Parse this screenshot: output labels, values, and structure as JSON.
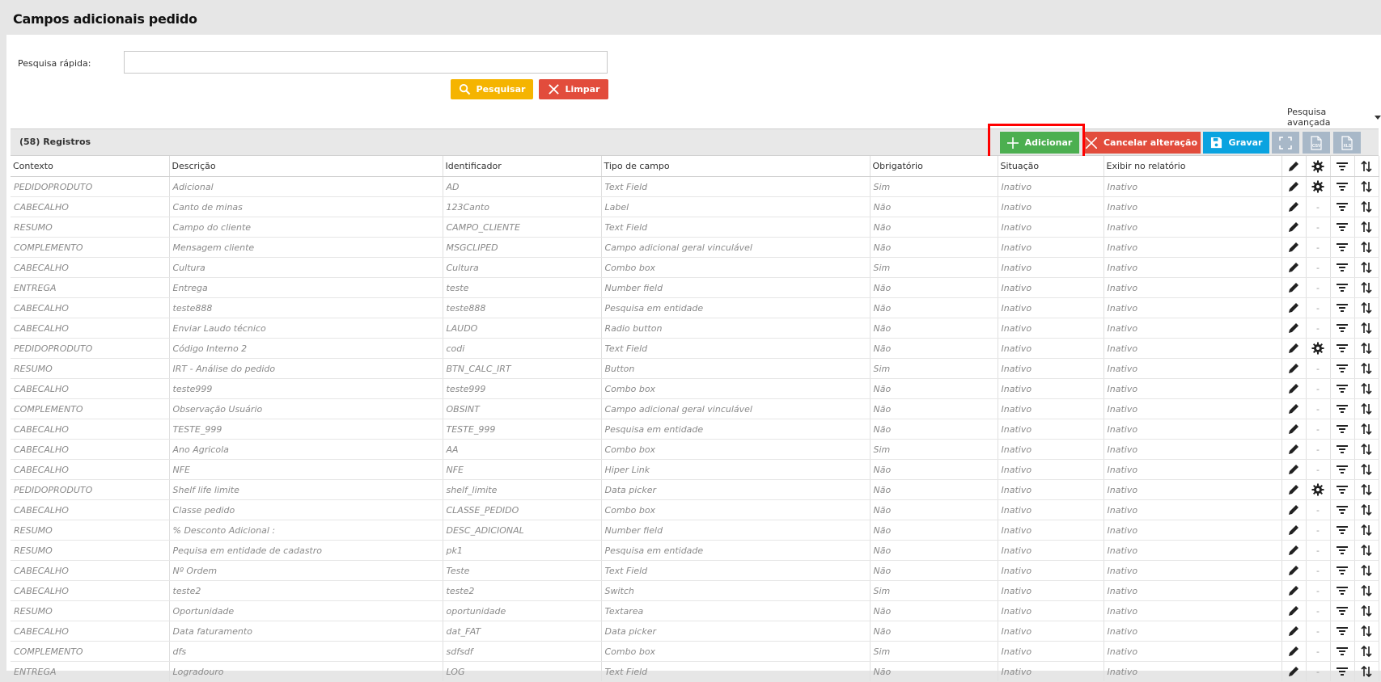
{
  "page": {
    "title": "Campos adicionais pedido"
  },
  "search": {
    "label": "Pesquisa rápida:",
    "value": "",
    "placeholder": "",
    "search_button": "Pesquisar",
    "clear_button": "Limpar",
    "advanced": "Pesquisa avançada"
  },
  "grid": {
    "count_label": "(58) Registros",
    "toolbar": {
      "add": "Adicionar",
      "cancel": "Cancelar alteração",
      "save": "Gravar",
      "expand_icon": "fullscreen-icon",
      "csv_icon": "csv-export-icon",
      "xls_icon": "xls-export-icon"
    },
    "columns": [
      "Contexto",
      "Descrição",
      "Identificador",
      "Tipo de campo",
      "Obrigatório",
      "Situação",
      "Exibir no relatório"
    ],
    "rows": [
      {
        "contexto": "PEDIDOPRODUTO",
        "descricao": "Adicional",
        "identificador": "AD",
        "tipo": "Text Field",
        "obrigatorio": "Sim",
        "situacao": "Inativo",
        "exibir": "Inativo",
        "gear": true
      },
      {
        "contexto": "CABECALHO",
        "descricao": "Canto de minas",
        "identificador": "123Canto",
        "tipo": "Label",
        "obrigatorio": "Não",
        "situacao": "Inativo",
        "exibir": "Inativo",
        "gear": false
      },
      {
        "contexto": "RESUMO",
        "descricao": "Campo do cliente",
        "identificador": "CAMPO_CLIENTE",
        "tipo": "Text Field",
        "obrigatorio": "Não",
        "situacao": "Inativo",
        "exibir": "Inativo",
        "gear": false
      },
      {
        "contexto": "COMPLEMENTO",
        "descricao": "Mensagem cliente",
        "identificador": "MSGCLIPED",
        "tipo": "Campo adicional geral vinculável",
        "obrigatorio": "Não",
        "situacao": "Inativo",
        "exibir": "Inativo",
        "gear": false
      },
      {
        "contexto": "CABECALHO",
        "descricao": "Cultura",
        "identificador": "Cultura",
        "tipo": "Combo box",
        "obrigatorio": "Sim",
        "situacao": "Inativo",
        "exibir": "Inativo",
        "gear": false
      },
      {
        "contexto": "ENTREGA",
        "descricao": "Entrega",
        "identificador": "teste",
        "tipo": "Number field",
        "obrigatorio": "Não",
        "situacao": "Inativo",
        "exibir": "Inativo",
        "gear": false
      },
      {
        "contexto": "CABECALHO",
        "descricao": "teste888",
        "identificador": "teste888",
        "tipo": "Pesquisa em entidade",
        "obrigatorio": "Não",
        "situacao": "Inativo",
        "exibir": "Inativo",
        "gear": false
      },
      {
        "contexto": "CABECALHO",
        "descricao": "Enviar Laudo técnico",
        "identificador": "LAUDO",
        "tipo": "Radio button",
        "obrigatorio": "Não",
        "situacao": "Inativo",
        "exibir": "Inativo",
        "gear": false
      },
      {
        "contexto": "PEDIDOPRODUTO",
        "descricao": "Código Interno 2",
        "identificador": "codi",
        "tipo": "Text Field",
        "obrigatorio": "Não",
        "situacao": "Inativo",
        "exibir": "Inativo",
        "gear": true
      },
      {
        "contexto": "RESUMO",
        "descricao": "IRT - Análise do pedido",
        "identificador": "BTN_CALC_IRT",
        "tipo": "Button",
        "obrigatorio": "Sim",
        "situacao": "Inativo",
        "exibir": "Inativo",
        "gear": false
      },
      {
        "contexto": "CABECALHO",
        "descricao": "teste999",
        "identificador": "teste999",
        "tipo": "Combo box",
        "obrigatorio": "Não",
        "situacao": "Inativo",
        "exibir": "Inativo",
        "gear": false
      },
      {
        "contexto": "COMPLEMENTO",
        "descricao": "Observação Usuário",
        "identificador": "OBSINT",
        "tipo": "Campo adicional geral vinculável",
        "obrigatorio": "Não",
        "situacao": "Inativo",
        "exibir": "Inativo",
        "gear": false
      },
      {
        "contexto": "CABECALHO",
        "descricao": "TESTE_999",
        "identificador": "TESTE_999",
        "tipo": "Pesquisa em entidade",
        "obrigatorio": "Não",
        "situacao": "Inativo",
        "exibir": "Inativo",
        "gear": false
      },
      {
        "contexto": "CABECALHO",
        "descricao": "Ano Agricola",
        "identificador": "AA",
        "tipo": "Combo box",
        "obrigatorio": "Sim",
        "situacao": "Inativo",
        "exibir": "Inativo",
        "gear": false
      },
      {
        "contexto": "CABECALHO",
        "descricao": "NFE",
        "identificador": "NFE",
        "tipo": "Hiper Link",
        "obrigatorio": "Não",
        "situacao": "Inativo",
        "exibir": "Inativo",
        "gear": false
      },
      {
        "contexto": "PEDIDOPRODUTO",
        "descricao": "Shelf life limite",
        "identificador": "shelf_limite",
        "tipo": "Data picker",
        "obrigatorio": "Não",
        "situacao": "Inativo",
        "exibir": "Inativo",
        "gear": true
      },
      {
        "contexto": "CABECALHO",
        "descricao": "Classe pedido",
        "identificador": "CLASSE_PEDIDO",
        "tipo": "Combo box",
        "obrigatorio": "Não",
        "situacao": "Inativo",
        "exibir": "Inativo",
        "gear": false
      },
      {
        "contexto": "RESUMO",
        "descricao": "% Desconto Adicional :",
        "identificador": "DESC_ADICIONAL",
        "tipo": "Number field",
        "obrigatorio": "Não",
        "situacao": "Inativo",
        "exibir": "Inativo",
        "gear": false
      },
      {
        "contexto": "RESUMO",
        "descricao": "Pequisa em entidade de cadastro",
        "identificador": "pk1",
        "tipo": "Pesquisa em entidade",
        "obrigatorio": "Não",
        "situacao": "Inativo",
        "exibir": "Inativo",
        "gear": false
      },
      {
        "contexto": "CABECALHO",
        "descricao": "Nº Ordem",
        "identificador": "Teste",
        "tipo": "Text Field",
        "obrigatorio": "Não",
        "situacao": "Inativo",
        "exibir": "Inativo",
        "gear": false
      },
      {
        "contexto": "CABECALHO",
        "descricao": "teste2",
        "identificador": "teste2",
        "tipo": "Switch",
        "obrigatorio": "Sim",
        "situacao": "Inativo",
        "exibir": "Inativo",
        "gear": false
      },
      {
        "contexto": "RESUMO",
        "descricao": "Oportunidade",
        "identificador": "oportunidade",
        "tipo": "Textarea",
        "obrigatorio": "Não",
        "situacao": "Inativo",
        "exibir": "Inativo",
        "gear": false
      },
      {
        "contexto": "CABECALHO",
        "descricao": "Data faturamento",
        "identificador": "dat_FAT",
        "tipo": "Data picker",
        "obrigatorio": "Não",
        "situacao": "Inativo",
        "exibir": "Inativo",
        "gear": false
      },
      {
        "contexto": "COMPLEMENTO",
        "descricao": "dfs",
        "identificador": "sdfsdf",
        "tipo": "Combo box",
        "obrigatorio": "Sim",
        "situacao": "Inativo",
        "exibir": "Inativo",
        "gear": false
      },
      {
        "contexto": "ENTREGA",
        "descricao": "Logradouro",
        "identificador": "LOG",
        "tipo": "Text Field",
        "obrigatorio": "Não",
        "situacao": "Inativo",
        "exibir": "Inativo",
        "gear": false
      }
    ],
    "no_gear_text": "-"
  },
  "colors": {
    "add": "#4caf50",
    "cancel": "#e24c3c",
    "save": "#0aa3e0",
    "search": "#f5b400",
    "highlight": "#ff0000"
  }
}
